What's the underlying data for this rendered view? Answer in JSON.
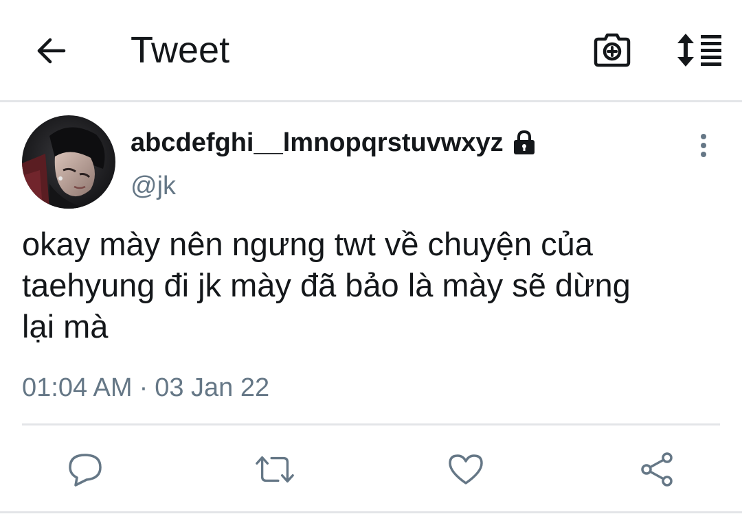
{
  "header": {
    "title": "Tweet",
    "back_icon": "arrow-left-icon",
    "camera_icon": "camera-add-icon",
    "sort_icon": "sort-list-icon"
  },
  "tweet": {
    "display_name": "abcdefghi__lmnopqrstuvwxyz",
    "protected_icon": "lock-icon",
    "handle": "@jk",
    "text": "okay mày nên ngưng twt về chuyện của\ntaehyung đi jk mày đã bảo là mày sẽ dừng\nlại mà",
    "time": "01:04 AM",
    "separator": "·",
    "date": "03 Jan 22",
    "more_icon": "more-vertical-icon"
  },
  "actions": [
    {
      "icon": "reply-icon"
    },
    {
      "icon": "retweet-icon"
    },
    {
      "icon": "like-icon"
    },
    {
      "icon": "share-icon"
    }
  ],
  "colors": {
    "text_primary": "#14171a",
    "text_secondary": "#657786",
    "icon_gray": "#657786",
    "divider": "#e3e5e8"
  }
}
